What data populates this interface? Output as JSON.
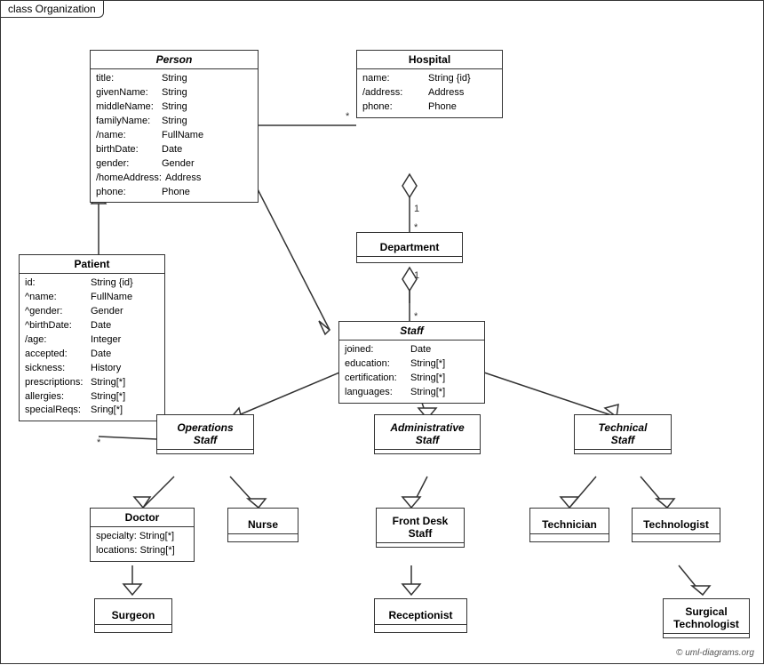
{
  "title": "class Organization",
  "copyright": "© uml-diagrams.org",
  "boxes": {
    "person": {
      "title": "Person",
      "attrs": [
        [
          "title:",
          "String"
        ],
        [
          "givenName:",
          "String"
        ],
        [
          "middleName:",
          "String"
        ],
        [
          "familyName:",
          "String"
        ],
        [
          "/name:",
          "FullName"
        ],
        [
          "birthDate:",
          "Date"
        ],
        [
          "gender:",
          "Gender"
        ],
        [
          "/homeAddress:",
          "Address"
        ],
        [
          "phone:",
          "Phone"
        ]
      ]
    },
    "hospital": {
      "title": "Hospital",
      "attrs": [
        [
          "name:",
          "String {id}"
        ],
        [
          "/address:",
          "Address"
        ],
        [
          "phone:",
          "Phone"
        ]
      ]
    },
    "patient": {
      "title": "Patient",
      "attrs": [
        [
          "id:",
          "String {id}"
        ],
        [
          "^name:",
          "FullName"
        ],
        [
          "^gender:",
          "Gender"
        ],
        [
          "^birthDate:",
          "Date"
        ],
        [
          "/age:",
          "Integer"
        ],
        [
          "accepted:",
          "Date"
        ],
        [
          "sickness:",
          "History"
        ],
        [
          "prescriptions:",
          "String[*]"
        ],
        [
          "allergies:",
          "String[*]"
        ],
        [
          "specialReqs:",
          "Sring[*]"
        ]
      ]
    },
    "department": {
      "title": "Department",
      "attrs": []
    },
    "staff": {
      "title": "Staff",
      "attrs": [
        [
          "joined:",
          "Date"
        ],
        [
          "education:",
          "String[*]"
        ],
        [
          "certification:",
          "String[*]"
        ],
        [
          "languages:",
          "String[*]"
        ]
      ]
    },
    "operations_staff": {
      "title": "Operations\nStaff",
      "attrs": []
    },
    "administrative_staff": {
      "title": "Administrative\nStaff",
      "attrs": []
    },
    "technical_staff": {
      "title": "Technical\nStaff",
      "attrs": []
    },
    "doctor": {
      "title": "Doctor",
      "attrs": [
        [
          "specialty:",
          "String[*]"
        ],
        [
          "locations:",
          "String[*]"
        ]
      ]
    },
    "nurse": {
      "title": "Nurse",
      "attrs": []
    },
    "front_desk_staff": {
      "title": "Front Desk\nStaff",
      "attrs": []
    },
    "technician": {
      "title": "Technician",
      "attrs": []
    },
    "technologist": {
      "title": "Technologist",
      "attrs": []
    },
    "surgeon": {
      "title": "Surgeon",
      "attrs": []
    },
    "receptionist": {
      "title": "Receptionist",
      "attrs": []
    },
    "surgical_technologist": {
      "title": "Surgical\nTechnologist",
      "attrs": []
    }
  }
}
